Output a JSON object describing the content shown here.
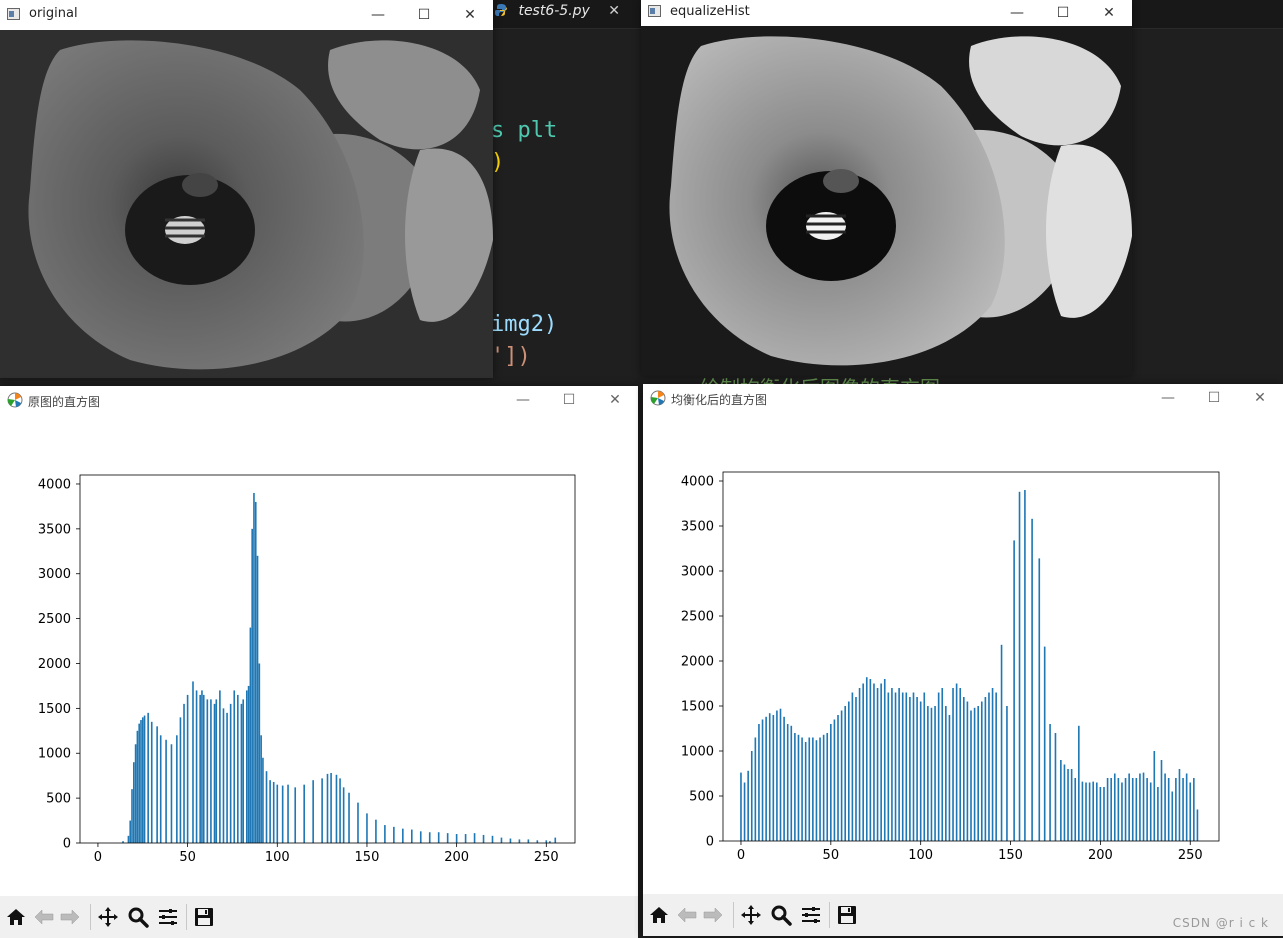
{
  "editor": {
    "tab_label": "test6-5.py",
    "tab_close": "✕",
    "code_fragments": [
      "s plt",
      ")",
      "img2)",
      "'])",
      "绘制均衡化后图像的直方图"
    ]
  },
  "windows": {
    "original": {
      "title": "original"
    },
    "equalize": {
      "title": "equalizeHist"
    },
    "hist_original": {
      "title": "原图的直方图"
    },
    "hist_equalized": {
      "title": "均衡化后的直方图"
    }
  },
  "window_controls": {
    "minimize": "—",
    "maximize": "☐",
    "close": "✕"
  },
  "toolbar_icons": [
    "home-icon",
    "back-arrow-icon",
    "forward-arrow-icon",
    "pan-icon",
    "zoom-icon",
    "configure-subplots-icon",
    "save-icon"
  ],
  "watermark": "CSDN @r i c k",
  "chart_data": [
    {
      "type": "bar",
      "name": "",
      "color": "#1f77b4",
      "xlim": [
        -10,
        266
      ],
      "ylim": [
        0,
        4100
      ],
      "xticks": [
        0,
        50,
        100,
        150,
        200,
        250
      ],
      "yticks": [
        0,
        500,
        1000,
        1500,
        2000,
        2500,
        3000,
        3500,
        4000
      ],
      "x": [
        10,
        14,
        17,
        18,
        19,
        20,
        21,
        22,
        23,
        24,
        25,
        26,
        28,
        30,
        33,
        35,
        38,
        41,
        44,
        46,
        48,
        50,
        53,
        55,
        57,
        58,
        59,
        61,
        63,
        65,
        66,
        68,
        70,
        72,
        74,
        76,
        78,
        80,
        81,
        83,
        84,
        85,
        86,
        87,
        88,
        89,
        90,
        91,
        92,
        94,
        96,
        98,
        100,
        103,
        106,
        110,
        115,
        120,
        125,
        128,
        130,
        133,
        135,
        137,
        140,
        145,
        150,
        155,
        160,
        165,
        170,
        175,
        180,
        185,
        190,
        195,
        200,
        205,
        210,
        215,
        220,
        225,
        230,
        235,
        240,
        245,
        250,
        252,
        255
      ],
      "values": [
        0,
        20,
        80,
        250,
        600,
        900,
        1100,
        1250,
        1330,
        1370,
        1400,
        1420,
        1450,
        1350,
        1300,
        1200,
        1150,
        1100,
        1200,
        1400,
        1550,
        1650,
        1800,
        1700,
        1650,
        1700,
        1650,
        1600,
        1600,
        1550,
        1600,
        1700,
        1500,
        1450,
        1550,
        1700,
        1650,
        1550,
        1600,
        1700,
        1750,
        2400,
        3500,
        3900,
        3800,
        3200,
        2000,
        1200,
        950,
        800,
        700,
        680,
        650,
        640,
        650,
        620,
        650,
        700,
        720,
        770,
        780,
        760,
        720,
        620,
        560,
        450,
        330,
        260,
        200,
        180,
        160,
        150,
        130,
        120,
        120,
        110,
        100,
        100,
        110,
        90,
        80,
        60,
        50,
        40,
        40,
        30,
        30,
        20,
        60
      ]
    },
    {
      "type": "bar",
      "name": "",
      "color": "#1f77b4",
      "xlim": [
        -10,
        266
      ],
      "ylim": [
        0,
        4100
      ],
      "xticks": [
        0,
        50,
        100,
        150,
        200,
        250
      ],
      "yticks": [
        0,
        500,
        1000,
        1500,
        2000,
        2500,
        3000,
        3500,
        4000
      ],
      "x": [
        0,
        2,
        4,
        6,
        8,
        10,
        12,
        14,
        16,
        18,
        20,
        22,
        24,
        26,
        28,
        30,
        32,
        34,
        36,
        38,
        40,
        42,
        44,
        46,
        48,
        50,
        52,
        54,
        56,
        58,
        60,
        62,
        64,
        66,
        68,
        70,
        72,
        74,
        76,
        78,
        80,
        82,
        84,
        86,
        88,
        90,
        92,
        94,
        96,
        98,
        100,
        102,
        104,
        106,
        108,
        110,
        112,
        114,
        116,
        118,
        120,
        122,
        124,
        126,
        128,
        130,
        132,
        134,
        136,
        138,
        140,
        142,
        145,
        148,
        152,
        155,
        158,
        162,
        166,
        169,
        172,
        175,
        178,
        180,
        182,
        184,
        186,
        188,
        190,
        192,
        194,
        196,
        198,
        200,
        202,
        204,
        206,
        208,
        210,
        212,
        214,
        216,
        218,
        220,
        222,
        224,
        226,
        228,
        230,
        232,
        234,
        236,
        238,
        240,
        242,
        244,
        246,
        248,
        250,
        252,
        254
      ],
      "values": [
        760,
        650,
        780,
        1000,
        1150,
        1300,
        1350,
        1380,
        1420,
        1400,
        1450,
        1470,
        1380,
        1300,
        1280,
        1200,
        1180,
        1150,
        1100,
        1150,
        1150,
        1120,
        1150,
        1180,
        1200,
        1300,
        1350,
        1400,
        1450,
        1500,
        1550,
        1650,
        1600,
        1700,
        1750,
        1820,
        1800,
        1750,
        1700,
        1750,
        1800,
        1650,
        1700,
        1650,
        1700,
        1650,
        1650,
        1600,
        1650,
        1600,
        1550,
        1650,
        1500,
        1480,
        1500,
        1650,
        1700,
        1500,
        1400,
        1700,
        1750,
        1700,
        1600,
        1550,
        1450,
        1480,
        1500,
        1550,
        1600,
        1650,
        1700,
        1650,
        2180,
        1500,
        3340,
        3880,
        3900,
        3580,
        3140,
        2160,
        1300,
        1200,
        900,
        850,
        800,
        800,
        700,
        1280,
        660,
        650,
        650,
        660,
        650,
        600,
        600,
        700,
        700,
        750,
        700,
        650,
        700,
        750,
        700,
        700,
        750,
        760,
        700,
        650,
        1000,
        600,
        900,
        750,
        700,
        550,
        700,
        800,
        700,
        750,
        650,
        700,
        350
      ]
    }
  ]
}
